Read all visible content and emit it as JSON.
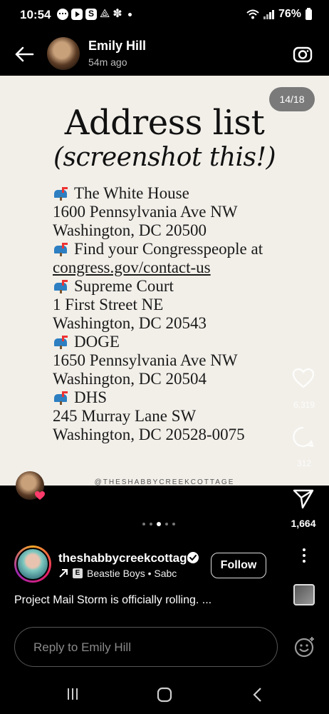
{
  "status_bar": {
    "time": "10:54",
    "battery": "76%",
    "notification_icons": [
      "messages-icon",
      "youtube-icon",
      "square-app-icon",
      "airbnb-icon",
      "flower-icon"
    ]
  },
  "header": {
    "user_name": "Emily Hill",
    "posted_ago": "54m ago"
  },
  "story": {
    "page_indicator": "14/18",
    "title": "Address list",
    "subtitle": "(screenshot this!)",
    "lines": [
      {
        "emoji": true,
        "text": "The White House",
        "link": false
      },
      {
        "emoji": false,
        "text": "1600 Pennsylvania Ave NW",
        "link": false
      },
      {
        "emoji": false,
        "text": "Washington, DC 20500",
        "link": false
      },
      {
        "emoji": true,
        "text": "Find your Congresspeople at",
        "link": false
      },
      {
        "emoji": false,
        "text": "congress.gov/contact-us",
        "link": true
      },
      {
        "emoji": true,
        "text": "Supreme Court",
        "link": false
      },
      {
        "emoji": false,
        "text": "1 First Street NE",
        "link": false
      },
      {
        "emoji": false,
        "text": "Washington, DC 20543",
        "link": false
      },
      {
        "emoji": true,
        "text": "DOGE",
        "link": false
      },
      {
        "emoji": false,
        "text": "1650 Pennsylvania Ave NW",
        "link": false
      },
      {
        "emoji": false,
        "text": "Washington, DC 20504",
        "link": false
      },
      {
        "emoji": true,
        "text": "DHS",
        "link": false
      },
      {
        "emoji": false,
        "text": "245 Murray Lane SW",
        "link": false
      },
      {
        "emoji": false,
        "text": "Washington, DC 20528-0075",
        "link": false
      }
    ],
    "watermark": "@THESHABBYCREEKCOTTAGE",
    "like_count": "6,319",
    "comment_count": "312",
    "share_count": "1,664",
    "carousel": {
      "total_dots": 5,
      "active_index": 2
    }
  },
  "account": {
    "handle": "theshabbycreekcottage",
    "explicit_badge": "E",
    "music": "Beastie Boys • Sabc",
    "follow_label": "Follow",
    "caption": "Project Mail Storm is officially rolling. ..."
  },
  "reply": {
    "placeholder": "Reply to Emily Hill"
  },
  "colors": {
    "story_background": "#f2efe9",
    "page_background": "#000000",
    "mailbox_blue": "#2d7fc1",
    "heart_badge": "#ff3b6b"
  }
}
